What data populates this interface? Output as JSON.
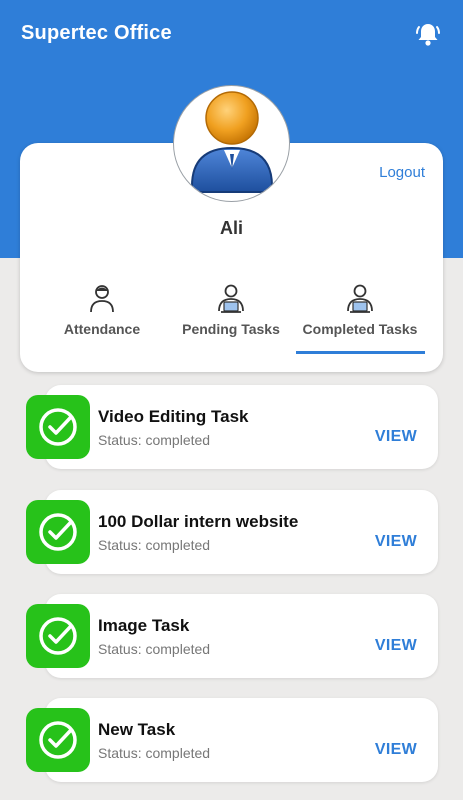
{
  "header": {
    "title": "Supertec Office",
    "icon": "bell-alert-icon",
    "background": "#2f7ed8"
  },
  "profile": {
    "name": "Ali",
    "logout_label": "Logout",
    "avatar_icon": "user-avatar-icon"
  },
  "tabs": [
    {
      "label": "Attendance",
      "icon": "person-icon",
      "active": false
    },
    {
      "label": "Pending Tasks",
      "icon": "person-laptop-icon",
      "active": false
    },
    {
      "label": "Completed Tasks",
      "icon": "person-laptop-icon",
      "active": true
    }
  ],
  "tasks": [
    {
      "title": "Video Editing Task",
      "status": "Status: completed",
      "action": "VIEW"
    },
    {
      "title": "100 Dollar intern website",
      "status": "Status: completed",
      "action": "VIEW"
    },
    {
      "title": "Image Task",
      "status": "Status: completed",
      "action": "VIEW"
    },
    {
      "title": "New Task",
      "status": "Status: completed",
      "action": "VIEW"
    }
  ],
  "colors": {
    "accent": "#2f7ed8",
    "success": "#27c21a",
    "background": "#ecebea"
  }
}
